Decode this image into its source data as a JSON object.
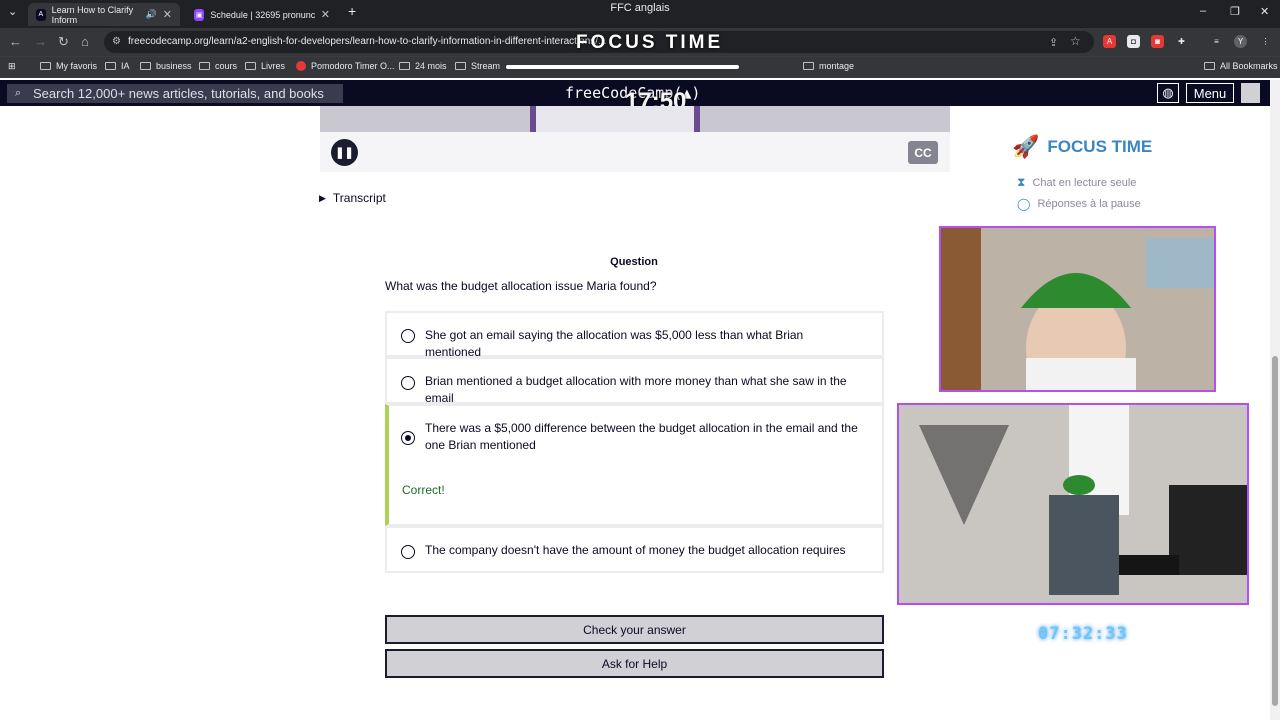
{
  "window": {
    "title": "FFC anglais",
    "controls": [
      "–",
      "❐",
      "✕"
    ]
  },
  "tabs": [
    {
      "label": "Learn How to Clarify Inform",
      "active": true
    },
    {
      "label": "Schedule | 32695 pronunciatio",
      "active": false
    }
  ],
  "address": {
    "url": "freecodecamp.org/learn/a2-english-for-developers/learn-how-to-clarify-information-in-different-interactions/..."
  },
  "overlay": {
    "focus_time_banner": "FOCUS TIME",
    "countdown": "17:50"
  },
  "bookmarks": [
    {
      "label": "My favoris",
      "icon": "folder-icon"
    },
    {
      "label": "IA",
      "icon": "folder-icon"
    },
    {
      "label": "business",
      "icon": "folder-icon"
    },
    {
      "label": "cours",
      "icon": "folder-icon"
    },
    {
      "label": "Livres",
      "icon": "folder-icon"
    },
    {
      "label": "Pomodoro Timer O...",
      "icon": "tomato-icon"
    },
    {
      "label": "24 mois",
      "icon": "folder-icon"
    },
    {
      "label": "Stream",
      "icon": "folder-icon"
    },
    {
      "label": "montage",
      "icon": "folder-icon"
    }
  ],
  "bookmarks_all": "All Bookmarks",
  "fccnav": {
    "search_placeholder": "Search 12,000+ news articles, tutorials, and books",
    "logo": "freeCodeCamp(▲)",
    "menu_label": "Menu"
  },
  "video": {
    "cc_label": "CC"
  },
  "transcript_label": "Transcript",
  "question": {
    "heading": "Question",
    "text": "What was the budget allocation issue Maria found?",
    "options": [
      {
        "label": "She got an email saying the allocation was $5,000 less than what Brian mentioned",
        "selected": false
      },
      {
        "label": "Brian mentioned a budget allocation with more money than what she saw in the email",
        "selected": false
      },
      {
        "label": "There was a $5,000 difference between the budget allocation in the email and the one Brian mentioned",
        "selected": true,
        "feedback": "Correct!"
      },
      {
        "label": "The company doesn't have the amount of money the budget allocation requires",
        "selected": false
      }
    ]
  },
  "buttons": {
    "check": "Check your answer",
    "help": "Ask for Help"
  },
  "stream_panel": {
    "title": "FOCUS TIME",
    "line1": "Chat en lecture seule",
    "line2": "Réponses à la pause",
    "timer": "07:32:33"
  },
  "colors": {
    "fcc_navy": "#0a0a23",
    "correct_green": "#acd157",
    "cam_border": "#b44ff0",
    "focus_blue": "#3a86c4"
  }
}
